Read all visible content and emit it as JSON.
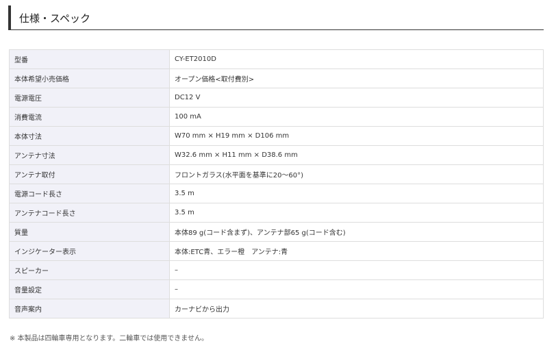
{
  "section": {
    "title": "仕様・スペック"
  },
  "specs": [
    {
      "label": "型番",
      "value": "CY-ET2010D"
    },
    {
      "label": "本体希望小売価格",
      "value": "オープン価格<取付費別>"
    },
    {
      "label": "電源電圧",
      "value": "DC12 V"
    },
    {
      "label": "消費電流",
      "value": "100 mA"
    },
    {
      "label": "本体寸法",
      "value": "W70 mm × H19 mm × D106 mm"
    },
    {
      "label": "アンテナ寸法",
      "value": "W32.6 mm × H11 mm × D38.6 mm"
    },
    {
      "label": "アンテナ取付",
      "value": "フロントガラス(水平面を基準に20〜60°)"
    },
    {
      "label": "電源コード長さ",
      "value": "3.5 m"
    },
    {
      "label": "アンテナコード長さ",
      "value": "3.5 m"
    },
    {
      "label": "質量",
      "value": "本体89 g(コード含まず)、アンテナ部65 g(コード含む)"
    },
    {
      "label": "インジケーター表示",
      "value": "本体:ETC青、エラー橙　アンテナ:青"
    },
    {
      "label": "スピーカー",
      "value": "–"
    },
    {
      "label": "音量設定",
      "value": "–"
    },
    {
      "label": "音声案内",
      "value": "カーナビから出力"
    }
  ],
  "footnote": "※ 本製品は四輪車専用となります。二輪車では使用できません。"
}
